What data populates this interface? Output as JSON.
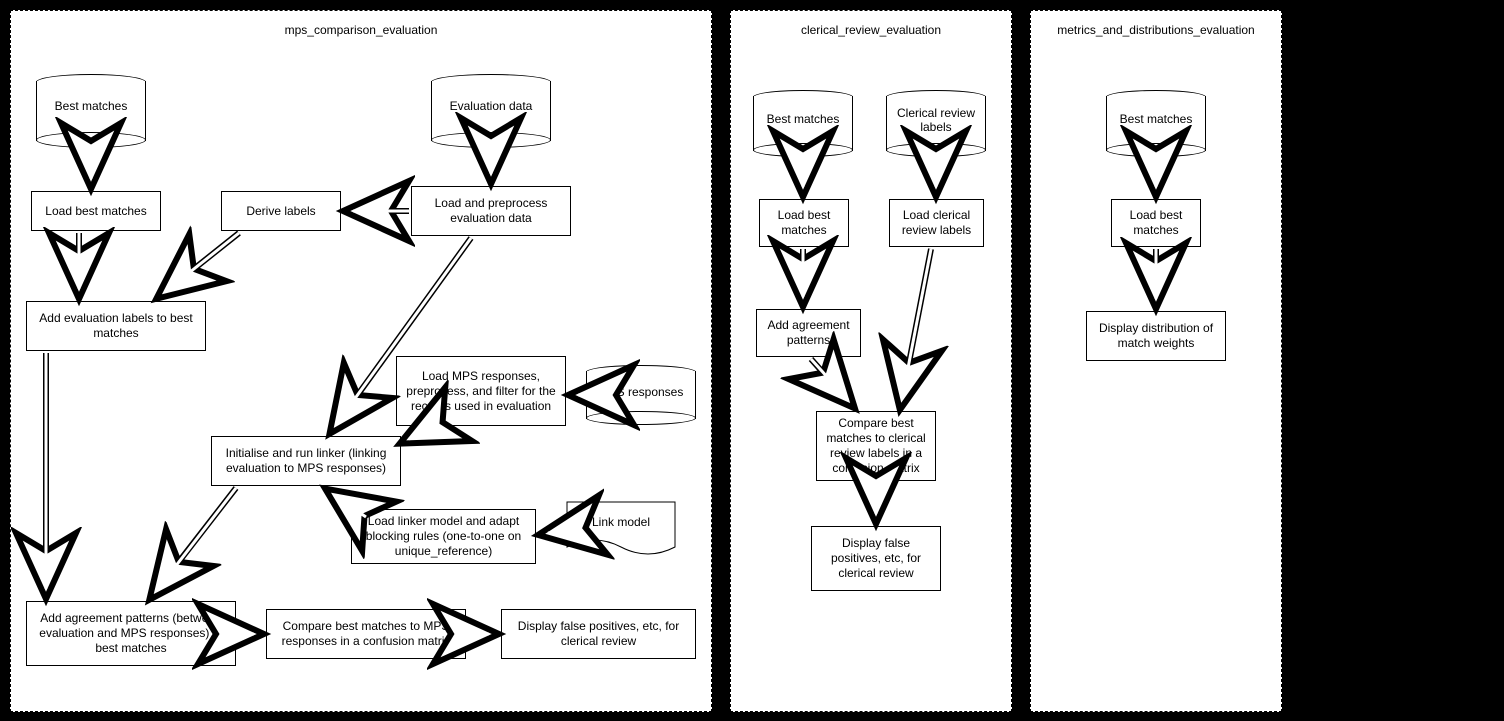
{
  "panels": {
    "p1": {
      "title": "mps_comparison_evaluation"
    },
    "p2": {
      "title": "clerical_review_evaluation"
    },
    "p3": {
      "title": "metrics_and_distributions_evaluation"
    }
  },
  "p1": {
    "cyl_best": "Best matches",
    "cyl_eval": "Evaluation data",
    "cyl_mps": "MPS responses",
    "doc_link": "Link model",
    "box_load_best": "Load best matches",
    "box_derive": "Derive labels",
    "box_load_eval": "Load and preprocess evaluation data",
    "box_add_eval": "Add evaluation labels to best matches",
    "box_load_mps": "Load MPS responses, preprocess, and filter for the records used in evaluation",
    "box_linker": "Initialise and run linker (linking evaluation to MPS responses)",
    "box_load_model": "Load linker model and adapt blocking rules (one-to-one on unique_reference)",
    "box_add_agree": "Add agreement patterns (between evaluation and MPS responses) to best matches",
    "box_compare": "Compare best matches to MPS responses in a confusion matrix",
    "box_display": "Display false positives, etc, for clerical review"
  },
  "p2": {
    "cyl_best": "Best matches",
    "cyl_clerical": "Clerical review labels",
    "box_load_best": "Load best matches",
    "box_load_clerical": "Load clerical review labels",
    "box_add_agree": "Add agreement patterns",
    "box_compare": "Compare best matches to clerical review labels in a confusion matrix",
    "box_display": "Display false positives, etc, for clerical review"
  },
  "p3": {
    "cyl_best": "Best matches",
    "box_load_best": "Load best matches",
    "box_display": "Display distribution of match weights"
  }
}
